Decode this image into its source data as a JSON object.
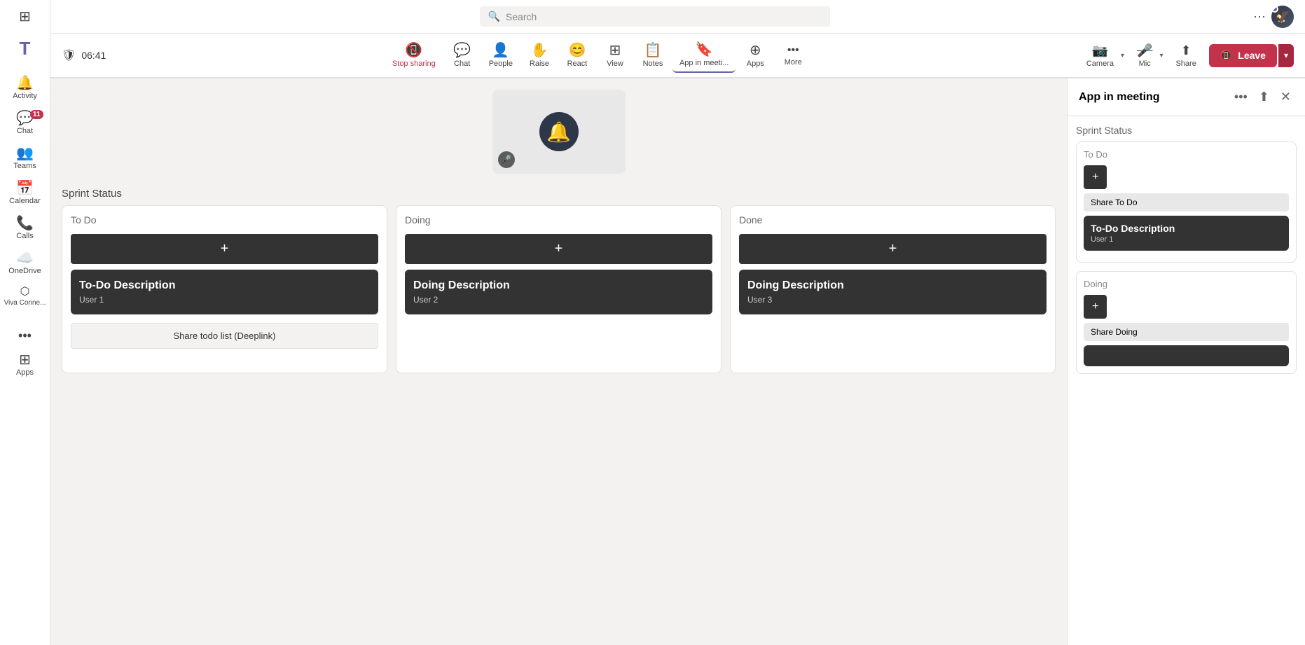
{
  "sidebar": {
    "logo": "T",
    "items": [
      {
        "id": "activity",
        "label": "Activity",
        "icon": "🔔",
        "badge": null
      },
      {
        "id": "chat",
        "label": "Chat",
        "icon": "💬",
        "badge": "11"
      },
      {
        "id": "teams",
        "label": "Teams",
        "icon": "👥",
        "badge": null
      },
      {
        "id": "calendar",
        "label": "Calendar",
        "icon": "📅",
        "badge": null
      },
      {
        "id": "calls",
        "label": "Calls",
        "icon": "📞",
        "badge": null
      },
      {
        "id": "onedrive",
        "label": "OneDrive",
        "icon": "☁️",
        "badge": null
      },
      {
        "id": "viva",
        "label": "Viva Conne...",
        "icon": "⬡",
        "badge": null
      }
    ],
    "more_label": "...",
    "apps_label": "Apps"
  },
  "topbar": {
    "search_placeholder": "Search",
    "dots": "···"
  },
  "meeting_toolbar": {
    "time": "06:41",
    "items": [
      {
        "id": "stop-sharing",
        "label": "Stop sharing",
        "icon": "📵",
        "color": "#c4314b"
      },
      {
        "id": "chat",
        "label": "Chat",
        "icon": "💬",
        "color": "#444"
      },
      {
        "id": "people",
        "label": "People",
        "icon": "👤",
        "color": "#444"
      },
      {
        "id": "raise",
        "label": "Raise",
        "icon": "✋",
        "color": "#444"
      },
      {
        "id": "react",
        "label": "React",
        "icon": "😊",
        "color": "#444"
      },
      {
        "id": "view",
        "label": "View",
        "icon": "⊞",
        "color": "#444"
      },
      {
        "id": "notes",
        "label": "Notes",
        "icon": "📋",
        "color": "#444"
      },
      {
        "id": "app-in-meeting",
        "label": "App in meeti...",
        "icon": "🔖",
        "color": "#444",
        "active": true
      },
      {
        "id": "apps",
        "label": "Apps",
        "icon": "⊕",
        "color": "#444"
      },
      {
        "id": "more",
        "label": "More",
        "icon": "···",
        "color": "#444"
      }
    ],
    "camera_label": "Camera",
    "mic_label": "Mic",
    "share_label": "Share",
    "leave_label": "Leave"
  },
  "sprint_board": {
    "title": "Sprint Status",
    "columns": [
      {
        "id": "todo",
        "title": "To Do",
        "tasks": [
          {
            "title": "To-Do Description",
            "user": "User 1"
          }
        ]
      },
      {
        "id": "doing",
        "title": "Doing",
        "tasks": [
          {
            "title": "Doing Description",
            "user": "User 2"
          }
        ]
      },
      {
        "id": "done",
        "title": "Done",
        "tasks": [
          {
            "title": "Doing Description",
            "user": "User 3"
          }
        ]
      }
    ],
    "share_link_label": "Share todo list (Deeplink)",
    "add_icon": "+"
  },
  "side_panel": {
    "title": "App in meeting",
    "sprint_title": "Sprint Status",
    "columns": [
      {
        "id": "todo",
        "title": "To Do",
        "add_label": "+",
        "share_label": "Share To Do",
        "tasks": [
          {
            "title": "To-Do Description",
            "user": "User 1"
          }
        ]
      },
      {
        "id": "doing",
        "title": "Doing",
        "add_label": "+",
        "share_label": "Share Doing",
        "tasks": []
      }
    ]
  }
}
